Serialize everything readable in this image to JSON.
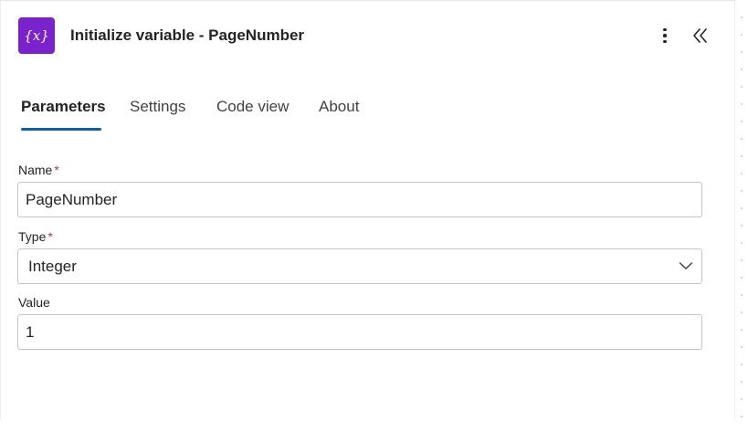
{
  "header": {
    "title": "Initialize variable - PageNumber",
    "icon": "variable-icon",
    "icon_glyph": "{x}",
    "icon_color": "#7a22cc"
  },
  "tabs": [
    {
      "label": "Parameters",
      "active": true
    },
    {
      "label": "Settings",
      "active": false
    },
    {
      "label": "Code view",
      "active": false
    },
    {
      "label": "About",
      "active": false
    }
  ],
  "form": {
    "name": {
      "label": "Name",
      "required_mark": "*",
      "value": "PageNumber"
    },
    "type": {
      "label": "Type",
      "required_mark": "*",
      "value": "Integer"
    },
    "value": {
      "label": "Value",
      "value": "1"
    }
  },
  "colors": {
    "accent": "#115ea3",
    "required": "#c4314b"
  }
}
